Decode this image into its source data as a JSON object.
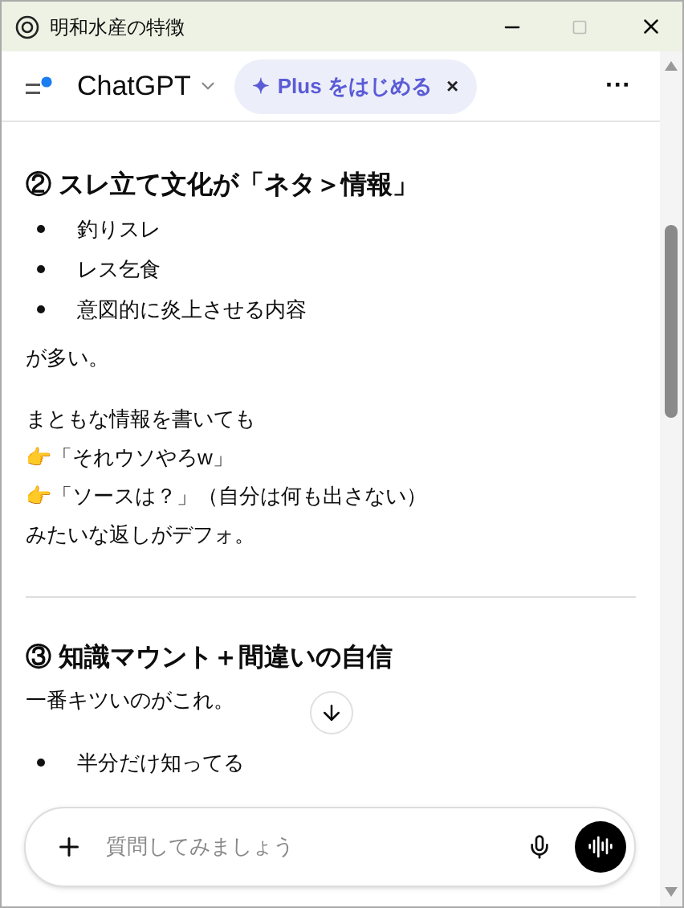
{
  "window": {
    "title": "明和水産の特徴"
  },
  "header": {
    "app_name": "ChatGPT",
    "promo": {
      "star": "✦",
      "label": "Plus をはじめる",
      "close": "×"
    },
    "more": "···"
  },
  "sections": [
    {
      "heading": "② スレ立て文化が「ネタ＞情報」",
      "blocks": [
        {
          "kind": "list",
          "items": [
            "釣りスレ",
            "レス乞食",
            "意図的に炎上させる内容"
          ]
        },
        {
          "kind": "paragraph",
          "lines": [
            "が多い。"
          ]
        },
        {
          "kind": "paragraph",
          "lines": [
            "まともな情報を書いても",
            "👉「それウソやろw」",
            "👉「ソースは？」（自分は何も出さない）",
            "みたいな返しがデフォ。"
          ]
        }
      ]
    },
    {
      "heading": "③ 知識マウント＋間違いの自信",
      "blocks": [
        {
          "kind": "paragraph",
          "lines": [
            "一番キツいのがこれ。"
          ]
        },
        {
          "kind": "list",
          "items": [
            "半分だけ知ってる"
          ]
        }
      ]
    }
  ],
  "composer": {
    "placeholder": "質問してみましょう"
  }
}
